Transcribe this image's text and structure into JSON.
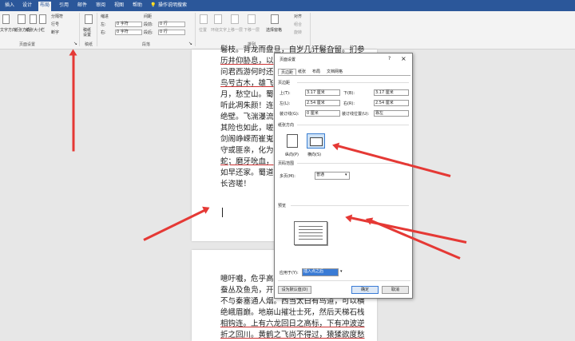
{
  "tabs": [
    "插入",
    "设计",
    "布局",
    "引用",
    "邮件",
    "审阅",
    "视图",
    "帮助",
    "操作说明搜索"
  ],
  "ribbon": {
    "text_direction": "文字方向",
    "margins": "页边距",
    "orientation": "纸张方向",
    "size": "纸张大小",
    "columns": "栏",
    "breaks": "分隔符",
    "line_numbers": "行号",
    "hyphenation": "断字",
    "manuscript": "稿纸设置",
    "indent_label": "缩进",
    "spacing_label": "间距",
    "left_label": "左:",
    "right_label": "右:",
    "before_label": "段前:",
    "after_label": "段后:",
    "indent_left": "0 字符",
    "indent_right": "0 字符",
    "space_before": "0 行",
    "space_after": "0 行",
    "position": "位置",
    "wrap": "环绕文字",
    "forward": "上移一层",
    "backward": "下移一层",
    "selection_pane": "选择窗格",
    "align": "对齐",
    "group": "组合",
    "rotate": "旋转",
    "group_page_setup": "页面设置",
    "group_manuscript": "稿纸",
    "group_paragraph": "段落",
    "group_arrange": "排列"
  },
  "document": {
    "page1_lines": [
      "鬈枝。背龙而盘旦，自岁几讦鬈旮留。扪参",
      "历井仰胁息，以",
      "问君西游何时还",
      "鸟号古木，雄飞",
      "月，愁空山。蜀",
      "听此凋朱颜！连",
      "绝壁。飞湍瀑流",
      "其险也如此，嗟",
      "剑阁峥嵘而崔嵬",
      "守或匪亲，化为",
      "蛇；磨牙吮血，",
      "如早还家。蜀道",
      "长咨嗟！"
    ],
    "page2_lines": [
      "噫吁嚱，危乎高",
      "蚕丛及鱼凫，开",
      "不与秦塞通人烟。西当太白有鸟道，可以横",
      "绝峨眉巅。地崩山摧壮士死，然后天梯石栈",
      "相钩连。上有六龙回日之高标，下有冲波逆",
      "折之回川。黄鹤之飞尚不得过，猿猱欲度愁"
    ]
  },
  "dialog": {
    "title": "页面设置",
    "help": "?",
    "close": "×",
    "tabs": [
      "页边距",
      "纸张",
      "布局",
      "文档网格"
    ],
    "margins_heading": "页边距",
    "top_label": "上(T):",
    "top_value": "3.17 厘米",
    "bottom_label": "下(B):",
    "bottom_value": "3.17 厘米",
    "left_label": "左(L):",
    "left_value": "2.54 厘米",
    "right_label": "右(R):",
    "right_value": "2.54 厘米",
    "gutter_label": "装订线(G):",
    "gutter_value": "0 厘米",
    "gutter_pos_label": "装订线位置(U):",
    "gutter_pos_value": "靠左",
    "orientation_heading": "纸张方向",
    "portrait": "纵向(P)",
    "landscape": "横向(S)",
    "pages_heading": "页码范围",
    "multiple_label": "多页(M):",
    "multiple_value": "普通",
    "preview_heading": "预览",
    "apply_label": "应用于(Y):",
    "apply_value": "插入点之后",
    "default_btn": "设为默认值(D)",
    "ok_btn": "确定",
    "cancel_btn": "取消"
  },
  "colors": {
    "accent": "#2b579a",
    "annotation_arrow": "#e53935"
  }
}
